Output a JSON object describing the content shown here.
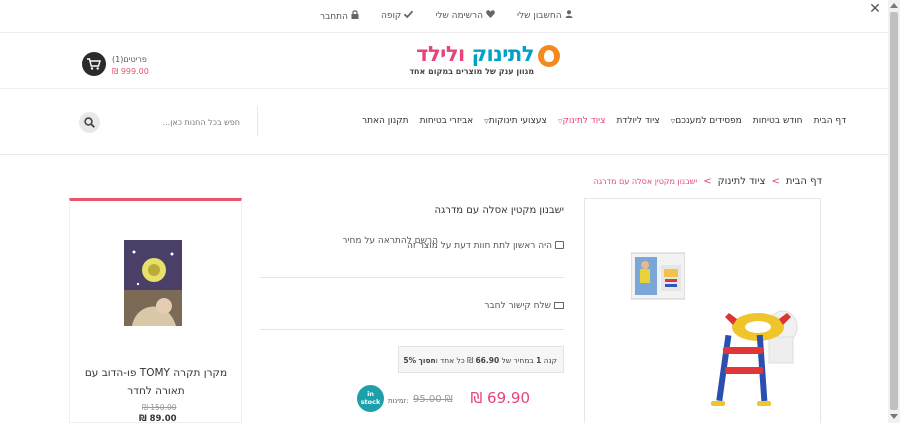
{
  "topbar": {
    "links": [
      {
        "label": "החשבון שלי",
        "icon": "user-icon"
      },
      {
        "label": "הרשימה שלי",
        "icon": "heart-icon"
      },
      {
        "label": "קופה",
        "icon": "check-icon"
      },
      {
        "label": "התחבר",
        "icon": "lock-icon"
      }
    ]
  },
  "cart": {
    "items": "(1)פריטים",
    "total": "₪ 999.00"
  },
  "logo": {
    "part1": "לתינוק",
    "part2": "ולילד",
    "tagline": "מגוון ענק של מוצרים במקום אחד"
  },
  "nav": {
    "items": [
      {
        "label": "דף הבית",
        "active": false
      },
      {
        "label": "חודש בטיחות",
        "active": false
      },
      {
        "label": "מפסידים למענכם",
        "active": false,
        "dropdown": true
      },
      {
        "label": "ציוד ליולדת",
        "active": false
      },
      {
        "label": "ציוד לתינוק",
        "active": true,
        "dropdown": true
      },
      {
        "label": "צעצועי תינוקות",
        "active": false,
        "dropdown": true
      },
      {
        "label": "אביזרי בטיחות",
        "active": false
      },
      {
        "label": "תקנון האתר",
        "active": false
      }
    ]
  },
  "search": {
    "placeholder": "חפש בכל החנות כאן..."
  },
  "breadcrumb": {
    "home": "דף הבית",
    "sep": ">",
    "category": "ציוד לתינוק",
    "current": "ישבנון מקטין אסלה עם מדרגה"
  },
  "product": {
    "title": "ישבנון מקטין אסלה עם מדרגה",
    "review_text": "היה ראשון לתת חוות דעת על מוצר זה",
    "alert_text": "הרשם להתראה על מחיר",
    "share_text": "שלח קישור לחבר",
    "deal": {
      "prefix": "קנה",
      "qty": "1",
      "mid": "במחיר של",
      "price": "66.90",
      "currency": "₪",
      "tail": "כל אחד ו",
      "save_word": "חסוך",
      "percent": "5%"
    },
    "price_new": "69.90 ₪",
    "price_old": "95.00 ₪",
    "availability_label": "זמינות:",
    "stock_badge": "in stock"
  },
  "sidebar_product": {
    "title": "מקרן תקרה TOMY פו-הדוב עם תאורה לחדר",
    "price_old": "₪ 150.00",
    "price_new": "₪ 89.00"
  },
  "colors": {
    "accent": "#e8437b",
    "brand_blue": "#00a1c7",
    "stock": "#1ca0a9"
  }
}
